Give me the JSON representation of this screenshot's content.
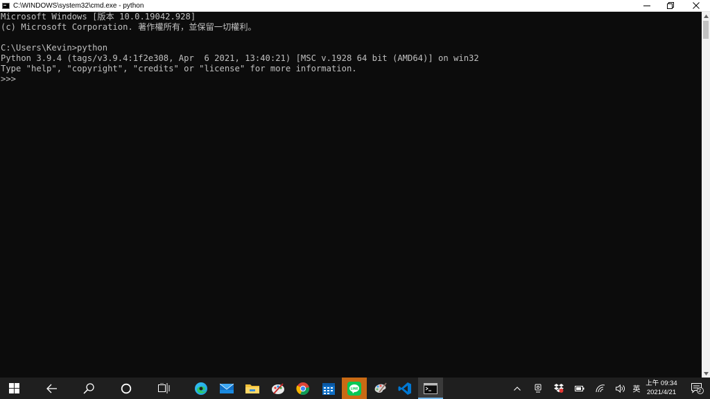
{
  "window": {
    "title": "C:\\WINDOWS\\system32\\cmd.exe - python",
    "minimize_glyph": "—",
    "restore_glyph": "❐",
    "close_glyph": "✕"
  },
  "console": {
    "lines": [
      "Microsoft Windows [版本 10.0.19042.928]",
      "(c) Microsoft Corporation. 著作權所有，並保留一切權利。",
      "",
      "C:\\Users\\Kevin>python",
      "Python 3.9.4 (tags/v3.9.4:1f2e308, Apr  6 2021, 13:40:21) [MSC v.1928 64 bit (AMD64)] on win32",
      "Type \"help\", \"copyright\", \"credits\" or \"license\" for more information.",
      ">>>"
    ]
  },
  "scrollbar": {
    "up_glyph": "▲",
    "down_glyph": "▼"
  },
  "taskbar": {
    "pinned": [
      "start-icon",
      "back-icon",
      "search-icon",
      "cortana-icon",
      "task-view-icon",
      "edge-icon",
      "mail-icon",
      "file-explorer-icon",
      "paint-icon",
      "chrome-icon",
      "calendar-icon",
      "line-icon",
      "paint3d-icon",
      "vscode-icon",
      "cmd-icon"
    ],
    "active_app": "cmd-icon",
    "tray": {
      "chevron_glyph": "^",
      "language": "英",
      "notification_count": "2"
    },
    "clock": {
      "time": "上午 09:34",
      "date": "2021/4/21"
    },
    "colors": {
      "taskbar_bg": "#1f1f1f",
      "active_indicator": "#76b9ed",
      "line_green": "#06c755",
      "vscode_blue": "#0078d4"
    }
  }
}
